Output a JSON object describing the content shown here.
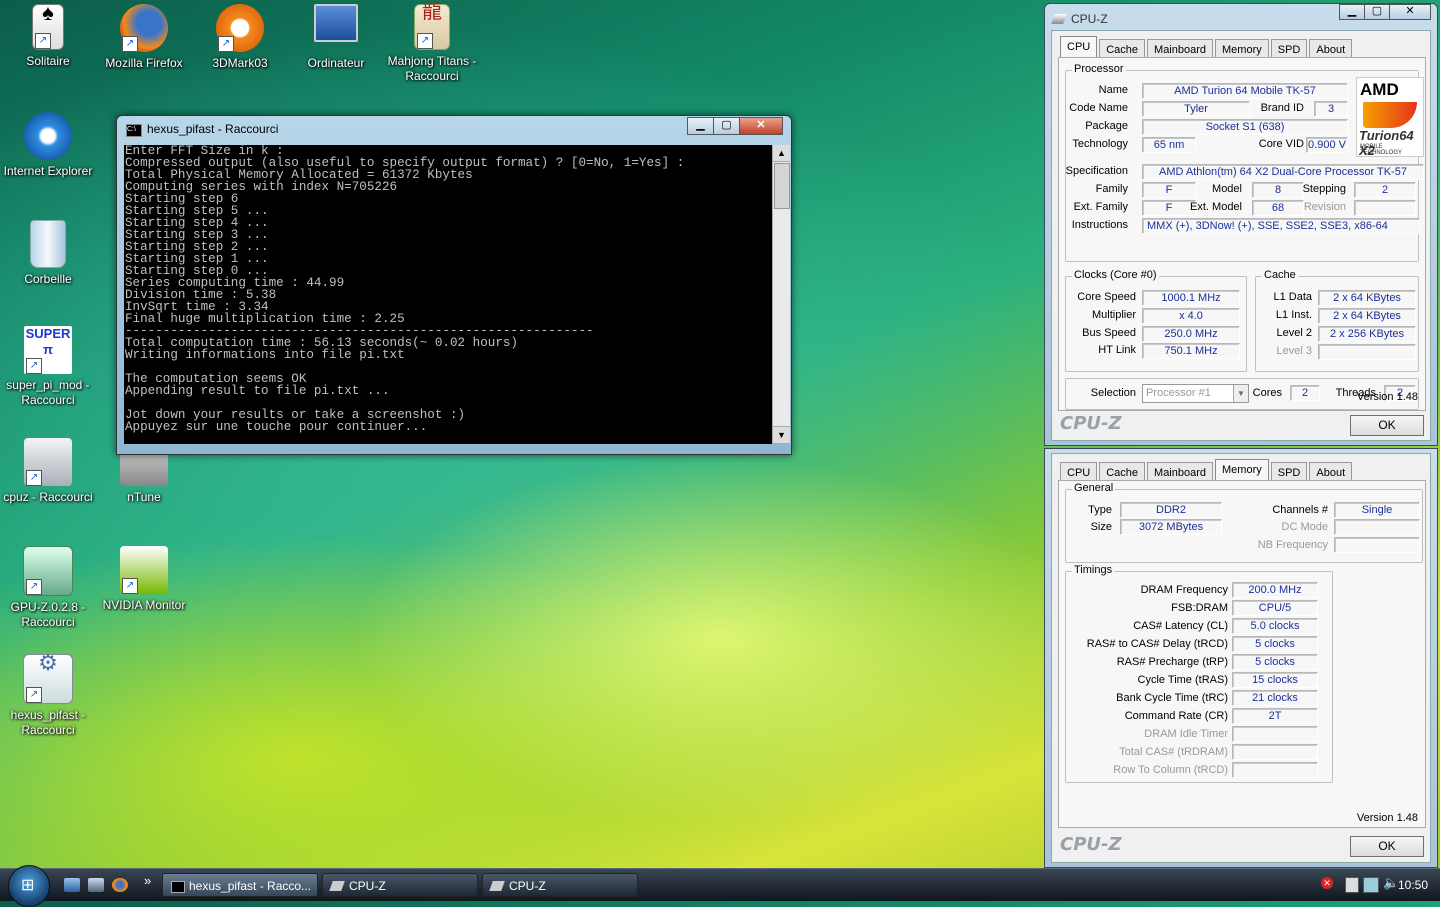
{
  "desktop": {
    "icons": [
      {
        "label": "Solitaire"
      },
      {
        "label": "Mozilla Firefox"
      },
      {
        "label": "3DMark03"
      },
      {
        "label": "Ordinateur"
      },
      {
        "label": "Mahjong Titans - Raccourci"
      },
      {
        "label": "Internet Explorer"
      },
      {
        "label": "Corbeille"
      },
      {
        "label": "super_pi_mod - Raccourci"
      },
      {
        "label": "cpuz - Raccourci"
      },
      {
        "label": "nTune"
      },
      {
        "label": "GPU-Z.0.2.8 - Raccourci"
      },
      {
        "label": "NVIDIA Monitor"
      },
      {
        "label": "hexus_pifast - Raccourci"
      }
    ]
  },
  "console_window": {
    "title": "hexus_pifast - Raccourci",
    "lines": [
      "Enter FFT Size in k :",
      "Compressed output (also useful to specify output format) ? [0=No, 1=Yes] :",
      "Total Physical Memory Allocated = 61372 Kbytes",
      "Computing series with index N=705226",
      "Starting step 6",
      "Starting step 5 ...",
      "Starting step 4 ...",
      "Starting step 3 ...",
      "Starting step 2 ...",
      "Starting step 1 ...",
      "Starting step 0 ...",
      "Series computing time : 44.99",
      "Division time : 5.38",
      "InvSqrt time : 3.34",
      "Final huge multiplication time : 2.25",
      "--------------------------------------------------------------",
      "Total computation time : 56.13 seconds(~ 0.02 hours)",
      "Writing informations into file pi.txt",
      "",
      "The computation seems OK",
      "Appending result to file pi.txt ...",
      "",
      "Jot down your results or take a screenshot :)",
      "Appuyez sur une touche pour continuer..."
    ]
  },
  "cpuz_cpu": {
    "title": "CPU-Z",
    "tabs": [
      "CPU",
      "Cache",
      "Mainboard",
      "Memory",
      "SPD",
      "About"
    ],
    "active_tab": "CPU",
    "processor_group": "Processor",
    "labels": {
      "name": "Name",
      "code_name": "Code Name",
      "brand_id": "Brand ID",
      "package": "Package",
      "technology": "Technology",
      "core_vid": "Core VID",
      "specification": "Specification",
      "family": "Family",
      "model": "Model",
      "stepping": "Stepping",
      "ext_family": "Ext. Family",
      "ext_model": "Ext. Model",
      "revision": "Revision",
      "instructions": "Instructions"
    },
    "values": {
      "name": "AMD Turion 64 Mobile TK-57",
      "code_name": "Tyler",
      "brand_id": "3",
      "package": "Socket S1 (638)",
      "technology": "65 nm",
      "core_vid": "0.900 V",
      "specification": "AMD Athlon(tm) 64 X2 Dual-Core Processor TK-57",
      "family": "F",
      "model": "8",
      "stepping": "2",
      "ext_family": "F",
      "ext_model": "68",
      "revision": "",
      "instructions": "MMX (+), 3DNow! (+), SSE, SSE2, SSE3, x86-64"
    },
    "logo": {
      "brand": "AMD",
      "line": "Turion64 X2",
      "sub": "MOBILE TECHNOLOGY"
    },
    "clocks_group": "Clocks (Core #0)",
    "clocks": [
      {
        "label": "Core Speed",
        "value": "1000.1 MHz"
      },
      {
        "label": "Multiplier",
        "value": "x 4.0"
      },
      {
        "label": "Bus Speed",
        "value": "250.0 MHz"
      },
      {
        "label": "HT Link",
        "value": "750.1 MHz"
      }
    ],
    "cache_group": "Cache",
    "cache": [
      {
        "label": "L1 Data",
        "value": "2 x 64 KBytes"
      },
      {
        "label": "L1 Inst.",
        "value": "2 x 64 KBytes"
      },
      {
        "label": "Level 2",
        "value": "2 x 256 KBytes"
      },
      {
        "label": "Level 3",
        "value": ""
      }
    ],
    "selection_label": "Selection",
    "selection_value": "Processor #1",
    "cores_label": "Cores",
    "cores_value": "2",
    "threads_label": "Threads",
    "threads_value": "2",
    "version": "Version 1.48",
    "brand": "CPU-Z",
    "ok_label": "OK"
  },
  "cpuz_memory": {
    "tabs": [
      "CPU",
      "Cache",
      "Mainboard",
      "Memory",
      "SPD",
      "About"
    ],
    "active_tab": "Memory",
    "general_group": "General",
    "type_label": "Type",
    "type_value": "DDR2",
    "size_label": "Size",
    "size_value": "3072 MBytes",
    "channels_label": "Channels #",
    "channels_value": "Single",
    "dc_mode_label": "DC Mode",
    "dc_mode_value": "",
    "nb_freq_label": "NB Frequency",
    "nb_freq_value": "",
    "timings_group": "Timings",
    "timings": [
      {
        "label": "DRAM Frequency",
        "value": "200.0 MHz"
      },
      {
        "label": "FSB:DRAM",
        "value": "CPU/5"
      },
      {
        "label": "CAS# Latency (CL)",
        "value": "5.0 clocks"
      },
      {
        "label": "RAS# to CAS# Delay (tRCD)",
        "value": "5 clocks"
      },
      {
        "label": "RAS# Precharge (tRP)",
        "value": "5 clocks"
      },
      {
        "label": "Cycle Time (tRAS)",
        "value": "15 clocks"
      },
      {
        "label": "Bank Cycle Time (tRC)",
        "value": "21 clocks"
      },
      {
        "label": "Command Rate (CR)",
        "value": "2T"
      },
      {
        "label": "DRAM Idle Timer",
        "value": ""
      },
      {
        "label": "Total CAS# (tRDRAM)",
        "value": ""
      },
      {
        "label": "Row To Column (tRCD)",
        "value": ""
      }
    ],
    "version": "Version 1.48",
    "brand": "CPU-Z",
    "ok_label": "OK"
  },
  "taskbar": {
    "buttons": [
      {
        "label": "hexus_pifast - Racco..."
      },
      {
        "label": "CPU-Z"
      },
      {
        "label": "CPU-Z"
      }
    ],
    "overflow": "»",
    "clock": "10:50"
  },
  "colors": {
    "value_text": "#1b2f9a",
    "console_bg": "#000000",
    "console_fg": "#c0c0c0"
  }
}
